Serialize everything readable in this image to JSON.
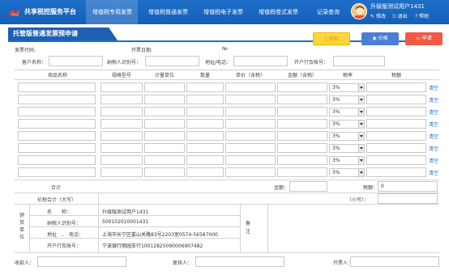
{
  "header": {
    "brand": "共享税控服务平台",
    "nav": [
      {
        "label": "增值税专用发票"
      },
      {
        "label": "增值税普通发票"
      },
      {
        "label": "增值税电子发票"
      },
      {
        "label": "增值税卷式发票"
      },
      {
        "label": "记录查询"
      }
    ],
    "user": {
      "name": "升级版测试用户1431",
      "modify": "修改",
      "logout": "退出",
      "help": "帮助"
    },
    "colors": {
      "primary": "#1e6ec8",
      "discount": "#fcd53b",
      "price": "#4a7fd6",
      "apply": "#f05a45"
    }
  },
  "page": {
    "title": "托管版普通发票预申请",
    "buttons": {
      "discount": "折扣",
      "price": "价格",
      "apply": "申请"
    },
    "meta": {
      "code_label": "发票代码:",
      "date_label": "开票日期:",
      "no_label": "№:"
    },
    "buyer": {
      "name_label": "客户名称：",
      "taxid_label": "纳税人识别号：",
      "addr_label": "地址/电话：",
      "bank_label": "开户行及账号："
    },
    "table": {
      "headers": [
        "商品名称",
        "规格型号",
        "计量单位",
        "数量",
        "单价（含税）",
        "金额（含税）",
        "税率",
        "税额"
      ],
      "rows": [
        {
          "rate": "3%",
          "clear": "清空"
        },
        {
          "rate": "3%",
          "clear": "清空"
        },
        {
          "rate": "3%",
          "clear": "清空"
        },
        {
          "rate": "3%",
          "clear": "清空"
        },
        {
          "rate": "3%",
          "clear": "清空"
        },
        {
          "rate": "3%",
          "clear": "清空"
        },
        {
          "rate": "3%",
          "clear": "清空"
        },
        {
          "rate": "3%",
          "clear": "清空"
        }
      ]
    },
    "totals": {
      "sum_label": "合计",
      "amount_label": "金额：",
      "tax_label": "税额：",
      "tax_value": "0",
      "total_label": "价税合计（大写）",
      "small_label": "（小写）："
    },
    "seller": {
      "side_label": "销货单位",
      "name_label": "名　　称：",
      "name_value": "升级版测试用户1431",
      "taxid_label": "纳税人识别号：",
      "taxid_value": "500102010001431",
      "addr_label": "地址　、　电话：",
      "addr_value": "上海市长宁区娄山关路83号2203室0574-56587000",
      "bank_label": "开户行及账号：",
      "bank_value": "宁波银行丽园支行10012825090006907482",
      "remark_label": "备注"
    },
    "footer": {
      "payee_label": "收款人：",
      "reviewer_label": "复核人：",
      "drawer_label": "开票人："
    }
  }
}
